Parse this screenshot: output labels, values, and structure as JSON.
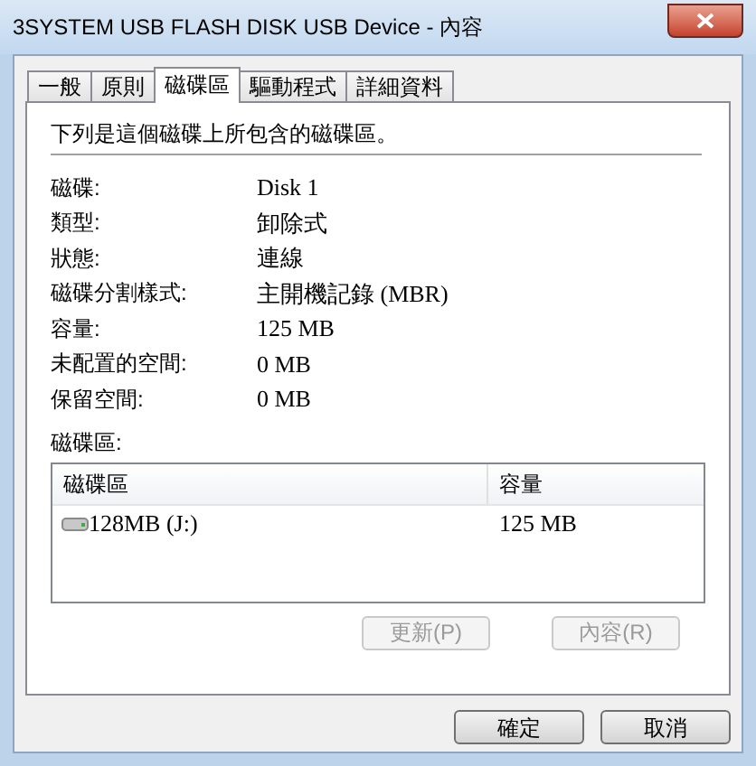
{
  "window": {
    "title": "3SYSTEM USB FLASH DISK USB Device - 內容"
  },
  "tabs": [
    {
      "label": "一般",
      "selected": false
    },
    {
      "label": "原則",
      "selected": false
    },
    {
      "label": "磁碟區",
      "selected": true
    },
    {
      "label": "驅動程式",
      "selected": false
    },
    {
      "label": "詳細資料",
      "selected": false
    }
  ],
  "description": "下列是這個磁碟上所包含的磁碟區。",
  "properties": [
    {
      "label": "磁碟:",
      "value": "Disk 1"
    },
    {
      "label": "類型:",
      "value": "卸除式"
    },
    {
      "label": "狀態:",
      "value": "連線"
    },
    {
      "label": "磁碟分割樣式:",
      "value": "主開機記錄 (MBR)"
    },
    {
      "label": "容量:",
      "value": "125 MB"
    },
    {
      "label": "未配置的空間:",
      "value": "0 MB"
    },
    {
      "label": "保留空間:",
      "value": "0 MB"
    }
  ],
  "volumes_label": "磁碟區:",
  "volumes_table": {
    "columns": [
      "磁碟區",
      "容量"
    ],
    "rows": [
      {
        "name": "128MB (J:)",
        "capacity": "125 MB"
      }
    ]
  },
  "panel_buttons": [
    {
      "label": "更新(P)",
      "disabled": true
    },
    {
      "label": "內容(R)",
      "disabled": true
    }
  ],
  "dialog_buttons": [
    {
      "label": "確定",
      "disabled": false
    },
    {
      "label": "取消",
      "disabled": false
    }
  ]
}
